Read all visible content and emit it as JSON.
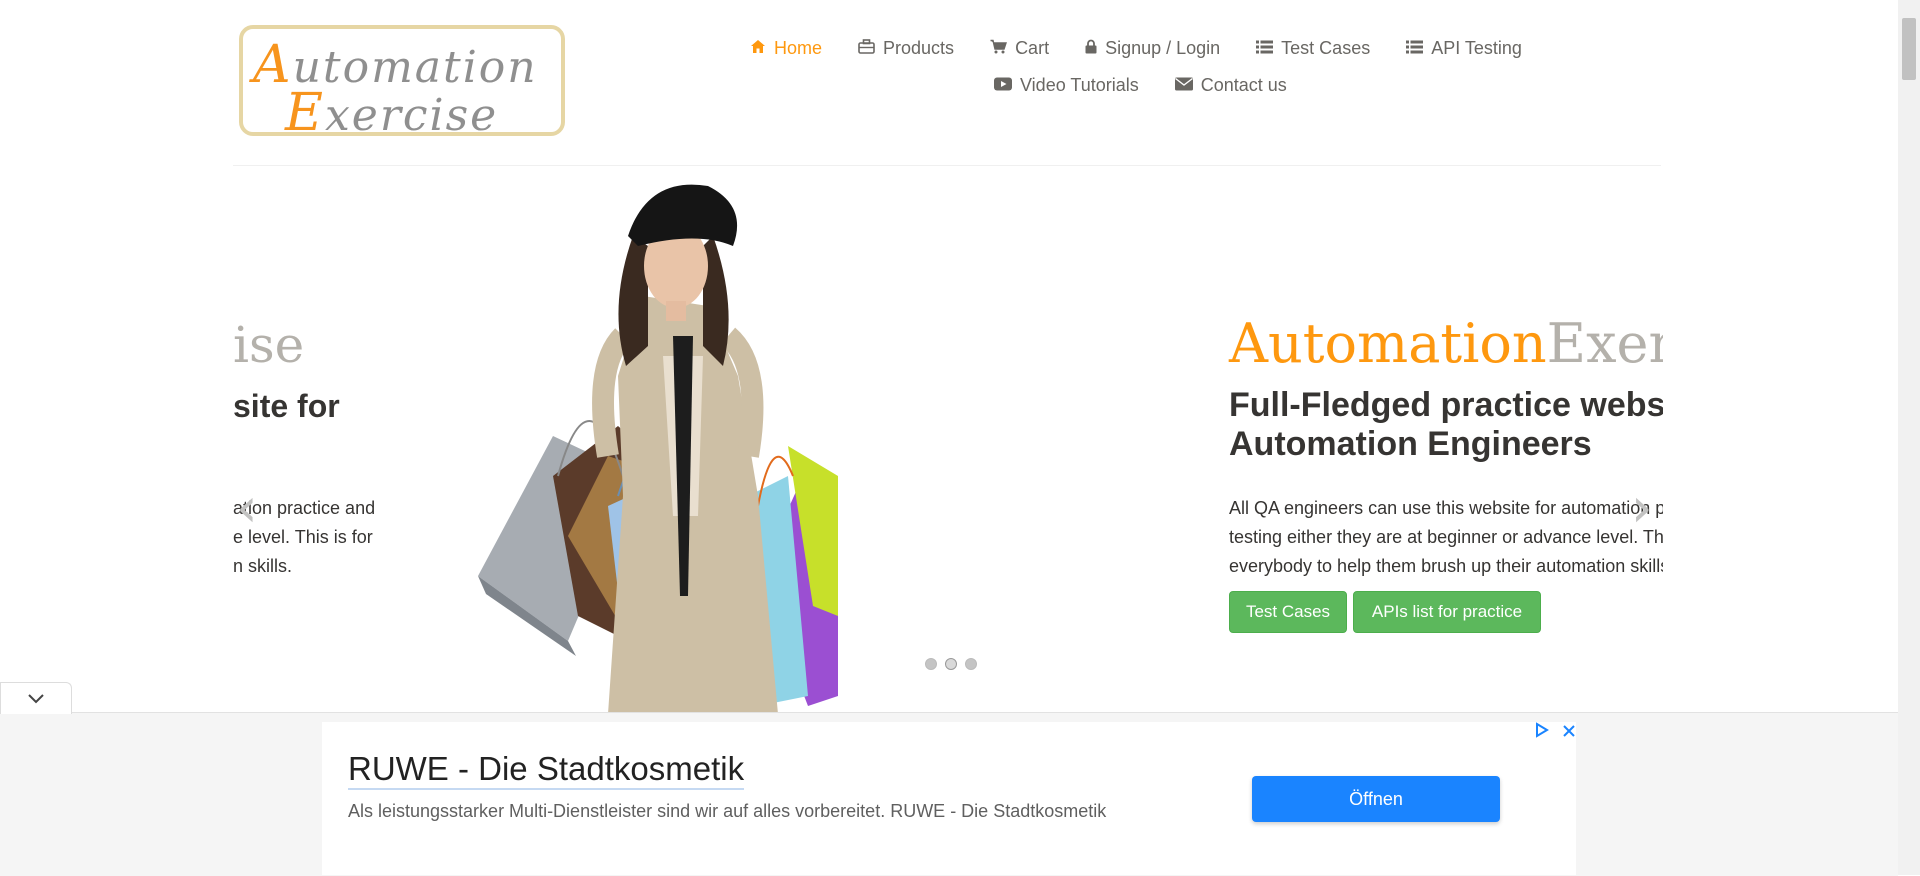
{
  "logo": {
    "line1_cap": "A",
    "line1_rest": "utomation",
    "line2_cap": "E",
    "line2_rest": "xercise"
  },
  "nav": {
    "items": [
      {
        "label": "Home",
        "icon": "home-icon"
      },
      {
        "label": "Products",
        "icon": "briefcase-icon"
      },
      {
        "label": "Cart",
        "icon": "cart-icon"
      },
      {
        "label": "Signup / Login",
        "icon": "lock-icon"
      },
      {
        "label": "Test Cases",
        "icon": "list-icon"
      },
      {
        "label": "API Testing",
        "icon": "list-icon"
      },
      {
        "label": "Video Tutorials",
        "icon": "youtube-icon"
      },
      {
        "label": "Contact us",
        "icon": "envelope-icon"
      }
    ],
    "active": "Home"
  },
  "slider": {
    "prev_slide": {
      "title": "ise",
      "subtitle": "site for",
      "text_lines": [
        "ation practice and",
        "e level. This is for",
        "n skills."
      ]
    },
    "current": {
      "brand_part1": "Automation",
      "brand_part2": "Exercise",
      "heading": "Full-Fledged practice website for Automation Engineers",
      "description": "All QA engineers can use this website for automation practice and API testing either they are at beginner or advance level. This is for everybody to help them brush up their automation skills.",
      "buttons": [
        "Test Cases",
        "APIs list for practice"
      ]
    },
    "prev_arrow": "‹",
    "next_arrow": "›",
    "dots": 3,
    "active_dot": 2
  },
  "ad": {
    "collapse_icon": "chevron-down-icon",
    "title": "RUWE - Die Stadtkosmetik",
    "text": "Als leistungsstarker Multi-Dienstleister sind wir auf alles vorbereitet. RUWE - Die Stadtkosmetik",
    "button": "Öffnen",
    "adchoices_icon": "adchoices-icon",
    "close_icon": "close-icon"
  },
  "colors": {
    "accent": "#fe980f",
    "nav_text": "#696763",
    "button_green": "#5cb85c",
    "ad_button": "#1a84ff"
  }
}
